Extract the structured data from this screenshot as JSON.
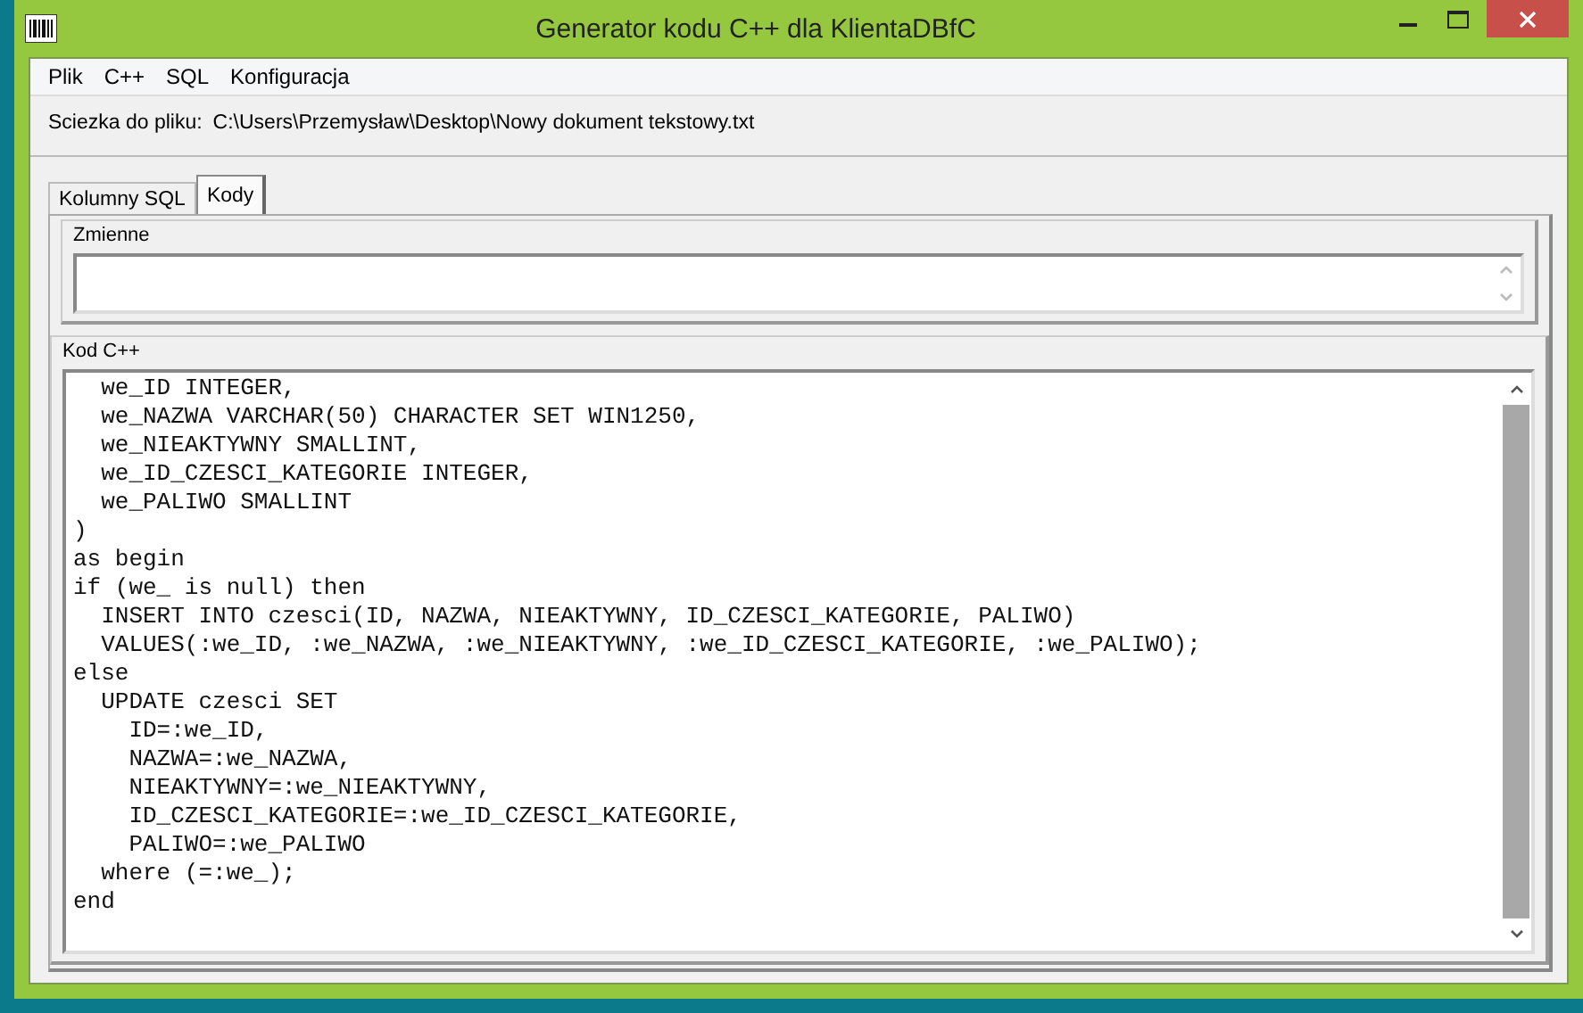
{
  "window": {
    "title": "Generator kodu C++ dla KlientaDBfC"
  },
  "menu": [
    "Plik",
    "C++",
    "SQL",
    "Konfiguracja"
  ],
  "path": {
    "label": "Sciezka do pliku:",
    "value": "C:\\Users\\Przemysław\\Desktop\\Nowy dokument tekstowy.txt"
  },
  "tabs": [
    {
      "label": "Kolumny SQL",
      "selected": false
    },
    {
      "label": "Kody",
      "selected": true
    }
  ],
  "variables": {
    "label": "Zmienne"
  },
  "code": {
    "label": "Kod C++",
    "lines": [
      "  we_ID INTEGER,",
      "  we_NAZWA VARCHAR(50) CHARACTER SET WIN1250,",
      "  we_NIEAKTYWNY SMALLINT,",
      "  we_ID_CZESCI_KATEGORIE INTEGER,",
      "  we_PALIWO SMALLINT",
      ")",
      "as begin",
      "if (we_ is null) then",
      "  INSERT INTO czesci(ID, NAZWA, NIEAKTYWNY, ID_CZESCI_KATEGORIE, PALIWO)",
      "  VALUES(:we_ID, :we_NAZWA, :we_NIEAKTYWNY, :we_ID_CZESCI_KATEGORIE, :we_PALIWO);",
      "else",
      "  UPDATE czesci SET",
      "    ID=:we_ID,",
      "    NAZWA=:we_NAZWA,",
      "    NIEAKTYWNY=:we_NIEAKTYWNY,",
      "    ID_CZESCI_KATEGORIE=:we_ID_CZESCI_KATEGORIE,",
      "    PALIWO=:we_PALIWO",
      "  where (=:we_);",
      "end"
    ]
  }
}
